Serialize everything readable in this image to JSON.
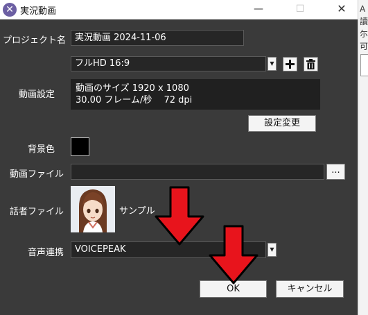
{
  "background_window": {
    "lines": [
      "A",
      "讀",
      "尓",
      "可"
    ]
  },
  "titlebar": {
    "app_icon_glyph": "✕",
    "title": "実況動画",
    "minimize_glyph": "—",
    "maximize_glyph": "☐",
    "close_glyph": "✕"
  },
  "form": {
    "project_label": "プロジェクト名",
    "project_value": "実況動画 2024-11-06",
    "preset_value": "フルHD 16:9",
    "video_settings_label": "動画設定",
    "video_info_line1": "動画のサイズ 1920 x 1080",
    "video_info_line2": "30.00 フレーム/秒　 72 dpi",
    "change_settings_label": "設定変更",
    "background_color_label": "背景色",
    "background_color": "#000000",
    "video_file_label": "動画ファイル",
    "video_file_value": "",
    "browse_label": "...",
    "speaker_file_label": "話者ファイル",
    "speaker_name": "サンプル",
    "voice_link_label": "音声連携",
    "voice_link_value": "VOICEPEAK"
  },
  "buttons": {
    "ok": "OK",
    "cancel": "キャンセル"
  },
  "colors": {
    "dialog_bg": "#3a3a3a",
    "field_bg": "#262626",
    "annotation_arrow": "#e8141c"
  },
  "icons": {
    "add": "plus-icon",
    "delete": "trash-icon"
  }
}
